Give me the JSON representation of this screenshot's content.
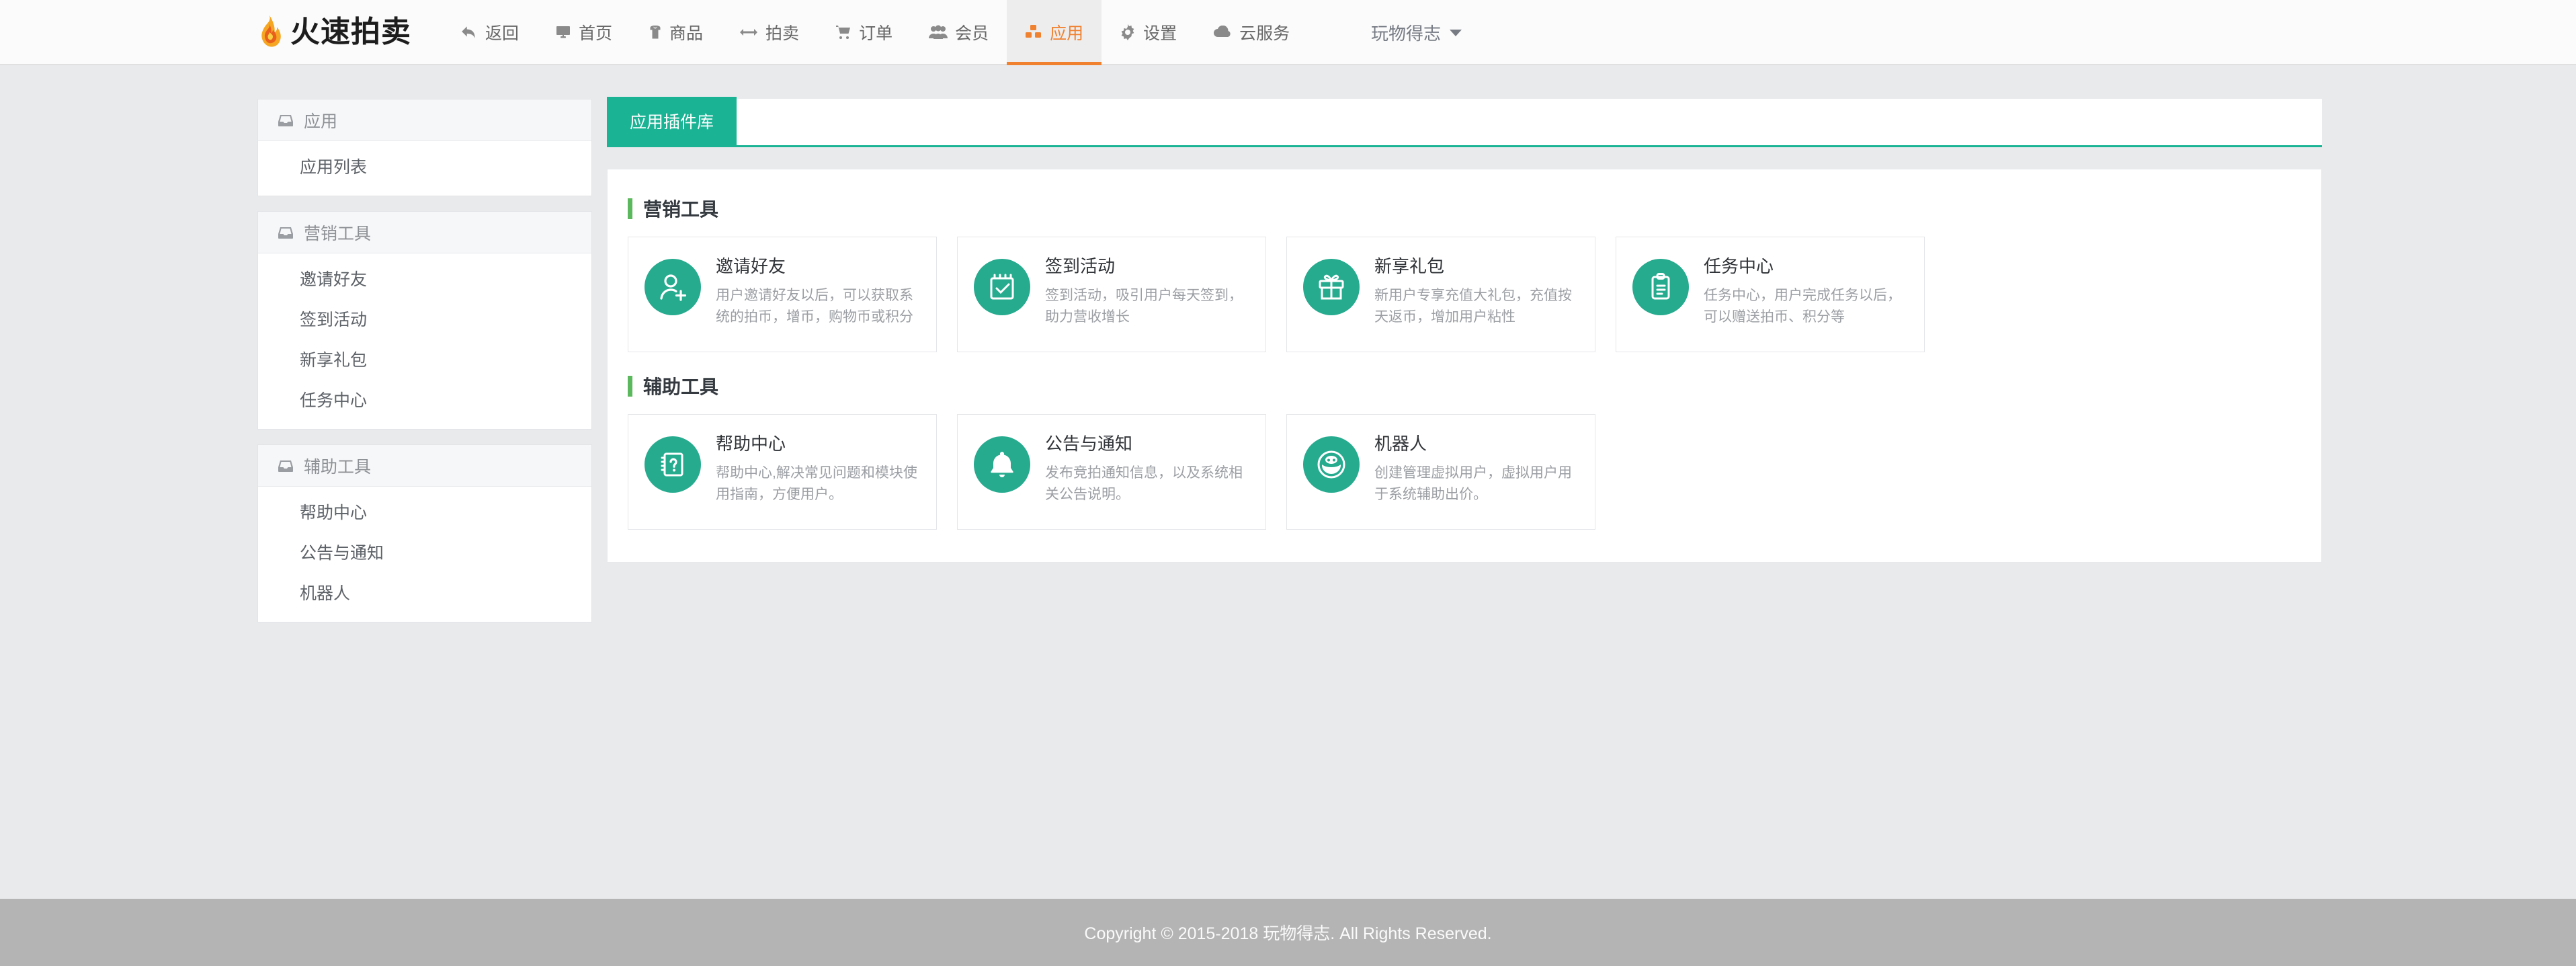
{
  "brand": {
    "name": "火速拍卖",
    "logo_icon": "flame-icon"
  },
  "nav": {
    "items": [
      {
        "label": "返回",
        "icon": "back-arrow-icon",
        "active": false
      },
      {
        "label": "首页",
        "icon": "desktop-icon",
        "active": false
      },
      {
        "label": "商品",
        "icon": "shirt-icon",
        "active": false
      },
      {
        "label": "拍卖",
        "icon": "arrows-icon",
        "active": false
      },
      {
        "label": "订单",
        "icon": "cart-icon",
        "active": false
      },
      {
        "label": "会员",
        "icon": "users-icon",
        "active": false
      },
      {
        "label": "应用",
        "icon": "cubes-icon",
        "active": true
      },
      {
        "label": "设置",
        "icon": "gear-icon",
        "active": false
      },
      {
        "label": "云服务",
        "icon": "cloud-icon",
        "active": false
      }
    ]
  },
  "user": {
    "name": "玩物得志",
    "caret_icon": "chevron-down-icon"
  },
  "sidebar": {
    "groups": [
      {
        "title": "应用",
        "icon": "inbox-icon",
        "items": [
          {
            "label": "应用列表"
          }
        ]
      },
      {
        "title": "营销工具",
        "icon": "inbox-icon",
        "items": [
          {
            "label": "邀请好友"
          },
          {
            "label": "签到活动"
          },
          {
            "label": "新享礼包"
          },
          {
            "label": "任务中心"
          }
        ]
      },
      {
        "title": "辅助工具",
        "icon": "inbox-icon",
        "items": [
          {
            "label": "帮助中心"
          },
          {
            "label": "公告与通知"
          },
          {
            "label": "机器人"
          }
        ]
      }
    ]
  },
  "tabs": [
    {
      "label": "应用插件库",
      "active": true
    }
  ],
  "sections": [
    {
      "title": "营销工具",
      "cards": [
        {
          "title": "邀请好友",
          "desc": "用户邀请好友以后，可以获取系统的拍币，增币，购物币或积分",
          "icon": "user-plus-icon"
        },
        {
          "title": "签到活动",
          "desc": "签到活动，吸引用户每天签到，助力营收增长",
          "icon": "calendar-check-icon"
        },
        {
          "title": "新享礼包",
          "desc": "新用户专享充值大礼包，充值按天返币，增加用户粘性",
          "icon": "gift-icon"
        },
        {
          "title": "任务中心",
          "desc": "任务中心，用户完成任务以后，可以赠送拍币、积分等",
          "icon": "clipboard-icon"
        }
      ]
    },
    {
      "title": "辅助工具",
      "cards": [
        {
          "title": "帮助中心",
          "desc": "帮助中心,解决常见问题和模块使用指南，方便用户。",
          "icon": "question-book-icon"
        },
        {
          "title": "公告与通知",
          "desc": "发布竞拍通知信息，以及系统相关公告说明。",
          "icon": "bell-icon"
        },
        {
          "title": "机器人",
          "desc": "创建管理虚拟用户，虚拟用户用于系统辅助出价。",
          "icon": "robot-face-icon"
        }
      ]
    }
  ],
  "footer": {
    "text": "Copyright © 2015-2018 玩物得志. All Rights Reserved."
  },
  "colors": {
    "accent_teal": "#1ab394",
    "icon_teal": "#26ab8f",
    "active_orange": "#f0812f",
    "section_bar_green": "#5cb85c",
    "page_bg": "#e8eaec",
    "footer_bg": "#b4b4b4"
  }
}
